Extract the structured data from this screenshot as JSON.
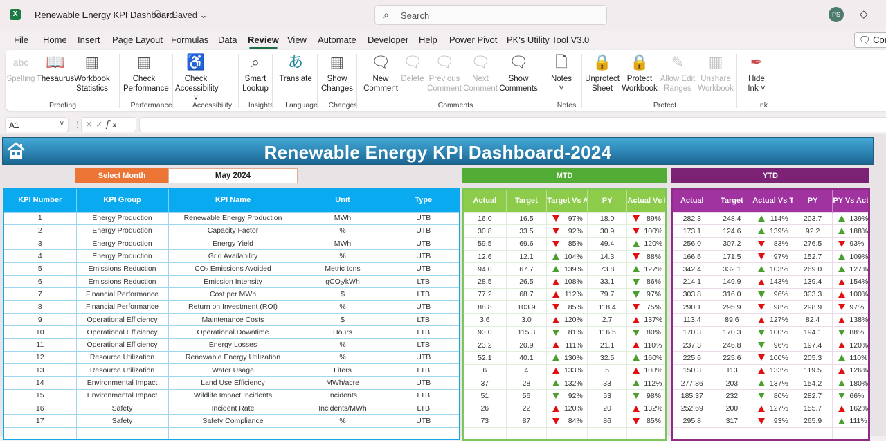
{
  "titlebar": {
    "app_icon": "excel-icon",
    "doc_title": "Renewable Energy KPI Dashboard",
    "share_icon": "share-people-icon",
    "saved_label": "• Saved",
    "search_placeholder": "Search",
    "avatar_initials": "PS",
    "premium_icon": "diamond-icon"
  },
  "menu_tabs": [
    "File",
    "Home",
    "Insert",
    "Page Layout",
    "Formulas",
    "Data",
    "Review",
    "View",
    "Automate",
    "Developer",
    "Help",
    "Power Pivot",
    "PK's Utility Tool V3.0"
  ],
  "active_tab": "Review",
  "comments_button": "Com",
  "ribbon": {
    "groups": [
      {
        "label": "Proofing",
        "buttons": [
          {
            "l1": "Spelling",
            "l2": "",
            "icon": "spelling-abc-icon",
            "disabled": true
          },
          {
            "l1": "Thesaurus",
            "l2": "",
            "icon": "thesaurus-book-icon"
          },
          {
            "l1": "Workbook",
            "l2": "Statistics",
            "icon": "workbook-statistics-icon"
          }
        ]
      },
      {
        "label": "Performance",
        "buttons": [
          {
            "l1": "Check",
            "l2": "Performance",
            "icon": "check-performance-icon"
          }
        ]
      },
      {
        "label": "Accessibility",
        "buttons": [
          {
            "l1": "Check",
            "l2": "Accessibility ˅",
            "icon": "check-accessibility-icon"
          }
        ]
      },
      {
        "label": "Insights",
        "buttons": [
          {
            "l1": "Smart",
            "l2": "Lookup",
            "icon": "smart-lookup-icon"
          }
        ]
      },
      {
        "label": "Language",
        "buttons": [
          {
            "l1": "Translate",
            "l2": "",
            "icon": "translate-icon"
          }
        ]
      },
      {
        "label": "Changes",
        "buttons": [
          {
            "l1": "Show",
            "l2": "Changes",
            "icon": "show-changes-icon"
          }
        ]
      },
      {
        "label": "Comments",
        "buttons": [
          {
            "l1": "New",
            "l2": "Comment",
            "icon": "new-comment-icon"
          },
          {
            "l1": "Delete",
            "l2": "",
            "icon": "delete-comment-icon",
            "disabled": true
          },
          {
            "l1": "Previous",
            "l2": "Comment",
            "icon": "previous-comment-icon",
            "disabled": true
          },
          {
            "l1": "Next",
            "l2": "Comment",
            "icon": "next-comment-icon",
            "disabled": true
          },
          {
            "l1": "Show",
            "l2": "Comments",
            "icon": "show-comments-icon"
          }
        ]
      },
      {
        "label": "Notes",
        "buttons": [
          {
            "l1": "Notes",
            "l2": "˅",
            "icon": "notes-icon"
          }
        ]
      },
      {
        "label": "Protect",
        "buttons": [
          {
            "l1": "Unprotect",
            "l2": "Sheet",
            "icon": "unprotect-sheet-icon"
          },
          {
            "l1": "Protect",
            "l2": "Workbook",
            "icon": "protect-workbook-icon"
          },
          {
            "l1": "Allow Edit",
            "l2": "Ranges",
            "icon": "allow-edit-ranges-icon",
            "disabled": true
          },
          {
            "l1": "Unshare",
            "l2": "Workbook",
            "icon": "unshare-workbook-icon",
            "disabled": true
          }
        ]
      },
      {
        "label": "Ink",
        "buttons": [
          {
            "l1": "Hide",
            "l2": "Ink ˅",
            "icon": "hide-ink-icon"
          }
        ]
      }
    ]
  },
  "formula_bar": {
    "name_box": "A1",
    "formula": ""
  },
  "dashboard": {
    "title": "Renewable Energy KPI Dashboard-2024",
    "select_month_label": "Select Month",
    "selected_month": "May 2024",
    "mtd_label": "MTD",
    "ytd_label": "YTD",
    "colors": {
      "up_good": "#4b9f2f",
      "down_bad": "#e01010",
      "mtd": "#52ac36",
      "ytd": "#7c2274",
      "main": "#0aaaf0",
      "select": "#ec7434"
    },
    "main_headers": [
      "KPI Number",
      "KPI Group",
      "KPI Name",
      "Unit",
      "Type"
    ],
    "mtd_headers": [
      "Actual",
      "Target",
      "Target Vs Actual",
      "PY",
      "Actual Vs PY"
    ],
    "ytd_headers": [
      "Actual",
      "Target",
      "Actual Vs Target",
      "PY",
      "PY Vs Actual"
    ],
    "rows": [
      {
        "num": "1",
        "group": "Energy Production",
        "name": "Renewable Energy Production",
        "unit": "MWh",
        "type": "UTB",
        "mtd": {
          "actual": "16.0",
          "target": "16.5",
          "tva": "97%",
          "tva_dir": "down",
          "tva_color": "red",
          "py": "18.0",
          "avp": "89%",
          "avp_dir": "down",
          "avp_color": "red"
        },
        "ytd": {
          "actual": "282.3",
          "target": "248.4",
          "avt": "114%",
          "avt_dir": "up",
          "avt_color": "green",
          "py": "203.7",
          "pva": "139%",
          "pva_dir": "up",
          "pva_color": "green"
        }
      },
      {
        "num": "2",
        "group": "Energy Production",
        "name": "Capacity Factor",
        "unit": "%",
        "type": "UTB",
        "mtd": {
          "actual": "30.8",
          "target": "33.5",
          "tva": "92%",
          "tva_dir": "down",
          "tva_color": "red",
          "py": "30.9",
          "avp": "100%",
          "avp_dir": "down",
          "avp_color": "red"
        },
        "ytd": {
          "actual": "173.1",
          "target": "124.6",
          "avt": "139%",
          "avt_dir": "up",
          "avt_color": "green",
          "py": "92.2",
          "pva": "188%",
          "pva_dir": "up",
          "pva_color": "green"
        }
      },
      {
        "num": "3",
        "group": "Energy Production",
        "name": "Energy Yield",
        "unit": "MWh",
        "type": "UTB",
        "mtd": {
          "actual": "59.5",
          "target": "69.6",
          "tva": "85%",
          "tva_dir": "down",
          "tva_color": "red",
          "py": "49.4",
          "avp": "120%",
          "avp_dir": "up",
          "avp_color": "green"
        },
        "ytd": {
          "actual": "256.0",
          "target": "307.2",
          "avt": "83%",
          "avt_dir": "down",
          "avt_color": "red",
          "py": "276.5",
          "pva": "93%",
          "pva_dir": "down",
          "pva_color": "red"
        }
      },
      {
        "num": "4",
        "group": "Energy Production",
        "name": "Grid Availability",
        "unit": "%",
        "type": "UTB",
        "mtd": {
          "actual": "12.6",
          "target": "12.1",
          "tva": "104%",
          "tva_dir": "up",
          "tva_color": "green",
          "py": "14.3",
          "avp": "88%",
          "avp_dir": "down",
          "avp_color": "red"
        },
        "ytd": {
          "actual": "166.6",
          "target": "171.5",
          "avt": "97%",
          "avt_dir": "down",
          "avt_color": "red",
          "py": "152.7",
          "pva": "109%",
          "pva_dir": "up",
          "pva_color": "green"
        }
      },
      {
        "num": "5",
        "group": "Emissions Reduction",
        "name": "CO₂ Emissions Avoided",
        "unit": "Metric tons",
        "type": "UTB",
        "mtd": {
          "actual": "94.0",
          "target": "67.7",
          "tva": "139%",
          "tva_dir": "up",
          "tva_color": "green",
          "py": "73.8",
          "avp": "127%",
          "avp_dir": "up",
          "avp_color": "green"
        },
        "ytd": {
          "actual": "342.4",
          "target": "332.1",
          "avt": "103%",
          "avt_dir": "up",
          "avt_color": "green",
          "py": "269.0",
          "pva": "127%",
          "pva_dir": "up",
          "pva_color": "green"
        }
      },
      {
        "num": "6",
        "group": "Emissions Reduction",
        "name": "Emission Intensity",
        "unit": "gCO₂/kWh",
        "type": "LTB",
        "mtd": {
          "actual": "28.5",
          "target": "26.5",
          "tva": "108%",
          "tva_dir": "up",
          "tva_color": "red",
          "py": "33.1",
          "avp": "86%",
          "avp_dir": "down",
          "avp_color": "green"
        },
        "ytd": {
          "actual": "214.1",
          "target": "149.9",
          "avt": "143%",
          "avt_dir": "up",
          "avt_color": "red",
          "py": "139.4",
          "pva": "154%",
          "pva_dir": "up",
          "pva_color": "red"
        }
      },
      {
        "num": "7",
        "group": "Financial Performance",
        "name": "Cost per MWh",
        "unit": "$",
        "type": "LTB",
        "mtd": {
          "actual": "77.2",
          "target": "68.7",
          "tva": "112%",
          "tva_dir": "up",
          "tva_color": "red",
          "py": "79.7",
          "avp": "97%",
          "avp_dir": "down",
          "avp_color": "green"
        },
        "ytd": {
          "actual": "303.8",
          "target": "316.0",
          "avt": "96%",
          "avt_dir": "down",
          "avt_color": "green",
          "py": "303.3",
          "pva": "100%",
          "pva_dir": "up",
          "pva_color": "red"
        }
      },
      {
        "num": "8",
        "group": "Financial Performance",
        "name": "Return on Investment (ROI)",
        "unit": "%",
        "type": "UTB",
        "mtd": {
          "actual": "88.8",
          "target": "103.9",
          "tva": "85%",
          "tva_dir": "down",
          "tva_color": "red",
          "py": "118.4",
          "avp": "75%",
          "avp_dir": "down",
          "avp_color": "red"
        },
        "ytd": {
          "actual": "290.1",
          "target": "295.9",
          "avt": "98%",
          "avt_dir": "down",
          "avt_color": "red",
          "py": "298.9",
          "pva": "97%",
          "pva_dir": "down",
          "pva_color": "red"
        }
      },
      {
        "num": "9",
        "group": "Operational Efficiency",
        "name": "Maintenance Costs",
        "unit": "$",
        "type": "LTB",
        "mtd": {
          "actual": "3.6",
          "target": "3.0",
          "tva": "120%",
          "tva_dir": "up",
          "tva_color": "red",
          "py": "2.7",
          "avp": "137%",
          "avp_dir": "up",
          "avp_color": "red"
        },
        "ytd": {
          "actual": "113.4",
          "target": "89.6",
          "avt": "127%",
          "avt_dir": "up",
          "avt_color": "red",
          "py": "82.4",
          "pva": "138%",
          "pva_dir": "up",
          "pva_color": "red"
        }
      },
      {
        "num": "10",
        "group": "Operational Efficiency",
        "name": "Operational Downtime",
        "unit": "Hours",
        "type": "LTB",
        "mtd": {
          "actual": "93.0",
          "target": "115.3",
          "tva": "81%",
          "tva_dir": "down",
          "tva_color": "green",
          "py": "116.5",
          "avp": "80%",
          "avp_dir": "down",
          "avp_color": "green"
        },
        "ytd": {
          "actual": "170.3",
          "target": "170.3",
          "avt": "100%",
          "avt_dir": "down",
          "avt_color": "green",
          "py": "194.1",
          "pva": "88%",
          "pva_dir": "down",
          "pva_color": "green"
        }
      },
      {
        "num": "11",
        "group": "Operational Efficiency",
        "name": "Energy Losses",
        "unit": "%",
        "type": "LTB",
        "mtd": {
          "actual": "23.2",
          "target": "20.9",
          "tva": "111%",
          "tva_dir": "up",
          "tva_color": "red",
          "py": "21.1",
          "avp": "110%",
          "avp_dir": "up",
          "avp_color": "red"
        },
        "ytd": {
          "actual": "237.3",
          "target": "246.8",
          "avt": "96%",
          "avt_dir": "down",
          "avt_color": "green",
          "py": "197.4",
          "pva": "120%",
          "pva_dir": "up",
          "pva_color": "red"
        }
      },
      {
        "num": "12",
        "group": "Resource Utilization",
        "name": "Renewable Energy Utilization",
        "unit": "%",
        "type": "UTB",
        "mtd": {
          "actual": "52.1",
          "target": "40.1",
          "tva": "130%",
          "tva_dir": "up",
          "tva_color": "green",
          "py": "32.5",
          "avp": "160%",
          "avp_dir": "up",
          "avp_color": "green"
        },
        "ytd": {
          "actual": "225.6",
          "target": "225.6",
          "avt": "100%",
          "avt_dir": "down",
          "avt_color": "red",
          "py": "205.3",
          "pva": "110%",
          "pva_dir": "up",
          "pva_color": "green"
        }
      },
      {
        "num": "13",
        "group": "Resource Utilization",
        "name": "Water Usage",
        "unit": "Liters",
        "type": "LTB",
        "mtd": {
          "actual": "6",
          "target": "4",
          "tva": "133%",
          "tva_dir": "up",
          "tva_color": "red",
          "py": "5",
          "avp": "108%",
          "avp_dir": "up",
          "avp_color": "red"
        },
        "ytd": {
          "actual": "150.3",
          "target": "113",
          "avt": "133%",
          "avt_dir": "up",
          "avt_color": "red",
          "py": "119.5",
          "pva": "126%",
          "pva_dir": "up",
          "pva_color": "red"
        }
      },
      {
        "num": "14",
        "group": "Environmental Impact",
        "name": "Land Use Efficiency",
        "unit": "MWh/acre",
        "type": "UTB",
        "mtd": {
          "actual": "37",
          "target": "28",
          "tva": "132%",
          "tva_dir": "up",
          "tva_color": "green",
          "py": "33",
          "avp": "112%",
          "avp_dir": "up",
          "avp_color": "green"
        },
        "ytd": {
          "actual": "277.86",
          "target": "203",
          "avt": "137%",
          "avt_dir": "up",
          "avt_color": "green",
          "py": "154.2",
          "pva": "180%",
          "pva_dir": "up",
          "pva_color": "green"
        }
      },
      {
        "num": "15",
        "group": "Environmental Impact",
        "name": "Wildlife Impact Incidents",
        "unit": "Incidents",
        "type": "LTB",
        "mtd": {
          "actual": "51",
          "target": "56",
          "tva": "92%",
          "tva_dir": "down",
          "tva_color": "green",
          "py": "53",
          "avp": "98%",
          "avp_dir": "down",
          "avp_color": "green"
        },
        "ytd": {
          "actual": "185.37",
          "target": "232",
          "avt": "80%",
          "avt_dir": "down",
          "avt_color": "green",
          "py": "282.7",
          "pva": "66%",
          "pva_dir": "down",
          "pva_color": "green"
        }
      },
      {
        "num": "16",
        "group": "Safety",
        "name": "Incident Rate",
        "unit": "Incidents/MWh",
        "type": "LTB",
        "mtd": {
          "actual": "26",
          "target": "22",
          "tva": "120%",
          "tva_dir": "up",
          "tva_color": "red",
          "py": "20",
          "avp": "132%",
          "avp_dir": "up",
          "avp_color": "red"
        },
        "ytd": {
          "actual": "252.69",
          "target": "200",
          "avt": "127%",
          "avt_dir": "up",
          "avt_color": "red",
          "py": "155.7",
          "pva": "162%",
          "pva_dir": "up",
          "pva_color": "red"
        }
      },
      {
        "num": "17",
        "group": "Safety",
        "name": "Safety Compliance",
        "unit": "%",
        "type": "UTB",
        "mtd": {
          "actual": "73",
          "target": "87",
          "tva": "84%",
          "tva_dir": "down",
          "tva_color": "red",
          "py": "86",
          "avp": "85%",
          "avp_dir": "down",
          "avp_color": "red"
        },
        "ytd": {
          "actual": "295.8",
          "target": "317",
          "avt": "93%",
          "avt_dir": "down",
          "avt_color": "red",
          "py": "265.9",
          "pva": "111%",
          "pva_dir": "up",
          "pva_color": "green"
        }
      }
    ]
  }
}
